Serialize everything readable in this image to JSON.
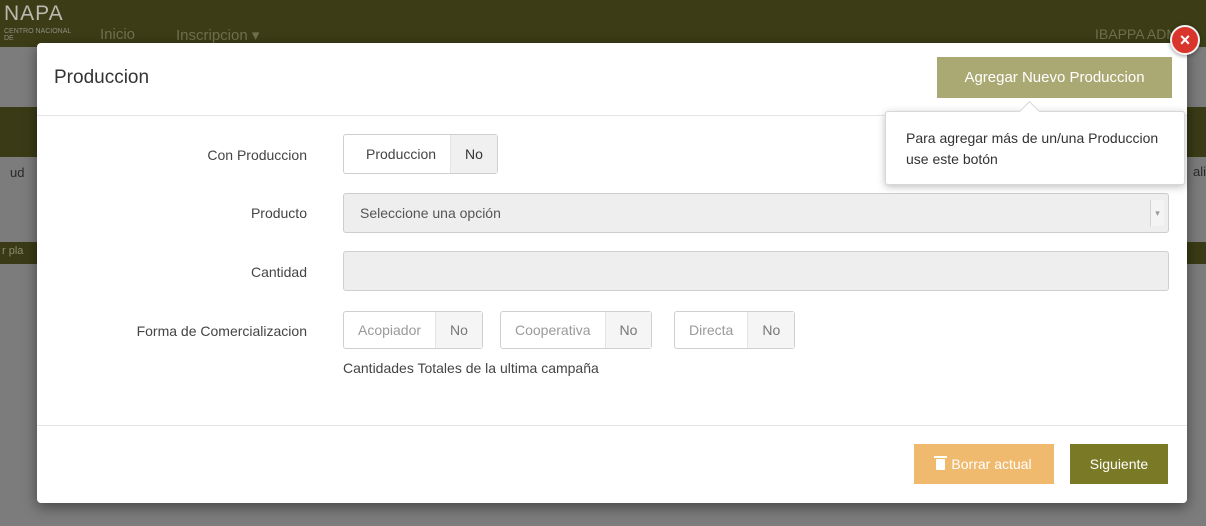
{
  "background": {
    "logo": "NAPA",
    "logo_sub": "CENTRO NACIONAL DE",
    "nav": [
      "Inicio",
      "Inscripcion ▾"
    ],
    "user": "IBAPPA ADM",
    "side_left_1": "ud",
    "side_left_2": "r pla",
    "side_right": "ali"
  },
  "modal": {
    "title": "Produccion",
    "add_button": "Agregar Nuevo Produccion",
    "tooltip": "Para agregar más de un/una Produccion use este botón",
    "close_label": "×",
    "fields": {
      "con_produccion_label": "Con Produccion",
      "con_produccion_toggle_label": "Produccion",
      "con_produccion_toggle_value": "No",
      "producto_label": "Producto",
      "producto_placeholder": "Seleccione una opción",
      "cantidad_label": "Cantidad",
      "cantidad_value": "",
      "forma_label": "Forma de Comercializacion",
      "acopiador_label": "Acopiador",
      "acopiador_value": "No",
      "cooperativa_label": "Cooperativa",
      "cooperativa_value": "No",
      "directa_label": "Directa",
      "directa_value": "No",
      "help_text": "Cantidades Totales de la ultima campaña"
    },
    "delete_button": "Borrar actual",
    "next_button": "Siguiente"
  },
  "colors": {
    "accent_olive": "#7a7a26",
    "add_button": "#aaa973",
    "delete_button": "#efba6d",
    "close_red": "#d9352d"
  }
}
